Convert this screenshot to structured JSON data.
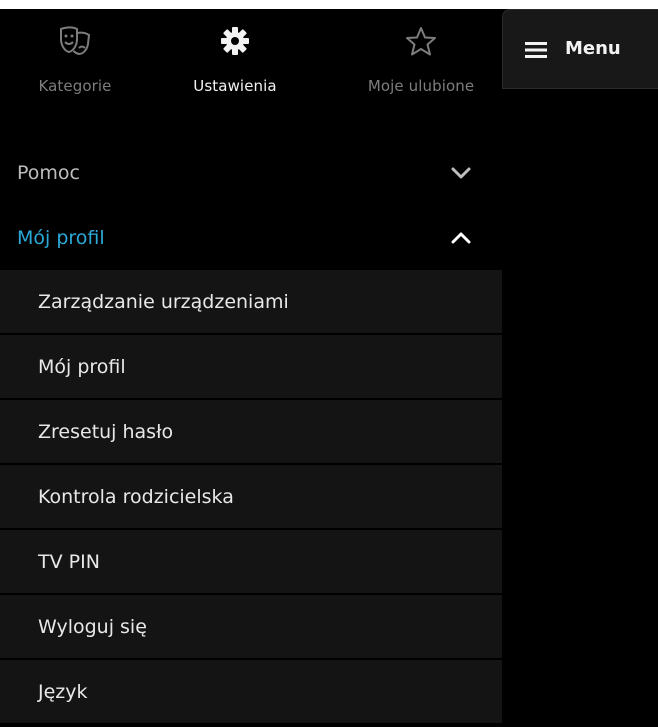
{
  "tabs": [
    {
      "label": "Kategorie",
      "icon": "theater-masks-icon",
      "active": false
    },
    {
      "label": "Ustawienia",
      "icon": "gear-icon",
      "active": true
    },
    {
      "label": "Moje ulubione",
      "icon": "star-icon",
      "active": false
    }
  ],
  "sections": {
    "help": {
      "label": "Pomoc",
      "expanded": false
    },
    "profile": {
      "label": "Mój profil",
      "expanded": true
    }
  },
  "profile_items": [
    "Zarządzanie urządzeniami",
    "Mój profil",
    "Zresetuj hasło",
    "Kontrola rodzicielska",
    "TV PIN",
    "Wyloguj się",
    "Język"
  ],
  "menu_panel": {
    "label": "Menu",
    "icon": "hamburger-icon"
  },
  "colors": {
    "background": "#000000",
    "accent": "#2ba9d8",
    "submenu_bg": "#141414",
    "inactive_text": "#7d7d7d"
  }
}
